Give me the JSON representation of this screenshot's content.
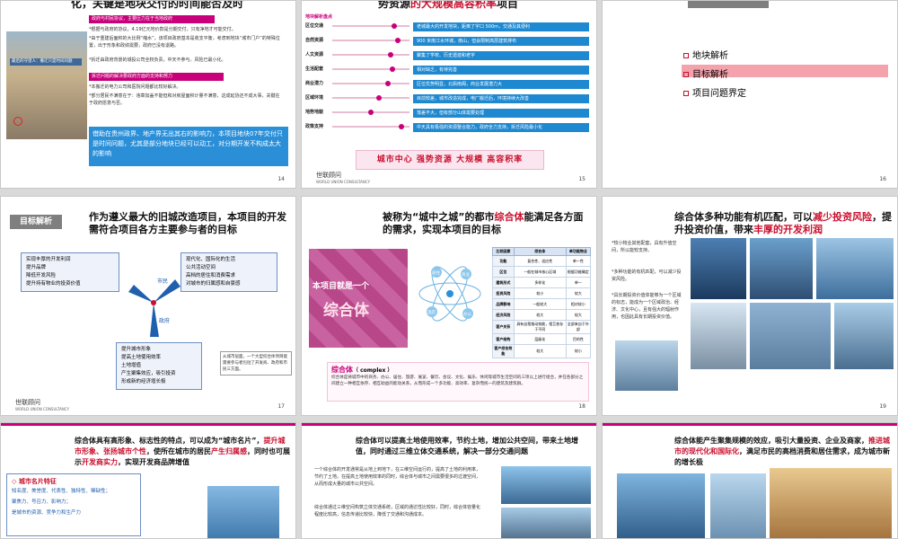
{
  "slides": {
    "s1": {
      "title": "化，关键是地块交付的时间能否及时",
      "banner1": "政府与村民协议，主要压力在于当地政府",
      "p1": "*根据与政府的协议，4.19亿元地价款是分期交付，只有净地才可能交付。",
      "p2": "*由于重建后面积的大比例“缩水”，该项目政府基本是收支平衡，考虑到地块“城市门户”的特殊位置，出于形象和政绩需要，政府已没有退路。",
      "p3": "*拆迁由政府背景的城投公司全权负责，中天不参与。风险已最小化。",
      "banner2": "拆迁问题的解决要政府方面的支持和努力",
      "p4": "*本搬迁的电力公司和医院问题都比较好解决。",
      "p5": "*部分居民不满意在于：违章加盖不能但和对房屋面积计量不满意，这成延协还不成大事，关键在于政府愿意与否。",
      "photo_caption": "最后的守望人：撤迁只是时间问题",
      "blue_text": "借助在贵州政界、地产界无出其右的影响力，本项目地块07年交付只是时间问题，尤其是部分地块已经可以动工，对分期开发不构成太大的影响",
      "page": "14"
    },
    "s2": {
      "title_plain": "势资源",
      "title_red": "的大规模高容积率",
      "title_tail": "项目",
      "section_label": "地块解析盘点",
      "rows": [
        {
          "label": "区位交通",
          "pct": 0.8,
          "text": "老城最大的开发地块，距离了字口 500m，交通及其便利"
        },
        {
          "label": "自然资源",
          "pct": 0.85,
          "text": "900 米南江水环城，南山，但会限制高层建筑排布"
        },
        {
          "label": "人文资源",
          "pct": 0.75,
          "text": "聚集了学校、历史遗迹和老宇"
        },
        {
          "label": "生活配套",
          "pct": 0.78,
          "text": "相对缺乏，有待完善"
        },
        {
          "label": "商业潜力",
          "pct": 0.72,
          "text": "区位优势明显，北衙南阁，商业发展潜力大"
        },
        {
          "label": "区域环境",
          "pct": 0.6,
          "text": "目前较差，城市改造完成，电厂搬迁后，环境持续大改善"
        },
        {
          "label": "地势地貌",
          "pct": 0.5,
          "text": "落差不大，但有部分山体需要处理"
        },
        {
          "label": "政策支持",
          "pct": 0.9,
          "text": "中天具有极强的资源整合能力，政府全力支持，拆迁风险最小化"
        }
      ],
      "slogan": "城市中心  强势资源  大规模  高容积率",
      "logo": "世联顾问",
      "logo_en": "WORLD UNION CONSULTANCY",
      "page": "15"
    },
    "s3": {
      "items": [
        "地块解析",
        "目标解析",
        "项目问题界定"
      ],
      "page": "16"
    },
    "s4": {
      "badge": "目标解析",
      "title": "作为遵义最大的旧城改造项目，本项目的开发需符合项目各方主要参与者的目标",
      "left_box": [
        "实现丰厚的开发利润",
        "提升品牌",
        "降低开发风险",
        "提升持有物业的投资价值"
      ],
      "right_box": [
        "现代化、国际化的生活",
        "公共活动空间",
        "高档的居住和消费需求",
        "对城市的归属感和自豪感"
      ],
      "bottom_box": [
        "提升城市形象",
        "提高土地使用效率",
        "土地增值",
        "产生聚集效应，吸引投资",
        "形成新的经济增长极"
      ],
      "arrow_labels": [
        "市民",
        "开发商",
        "政府"
      ],
      "note": "从城市层面，一个大型综合体项目能需要参与者包括了开发商、政府和市民三方面。",
      "logo": "世联顾问",
      "logo_en": "WORLD UNION CONSULTANCY",
      "page": "17"
    },
    "s5": {
      "title_plain": "被称为“城中之城”的都市",
      "title_red": "综合体",
      "title_tail": "能满足各方面的需求，实现本项目的目标",
      "big_label": "本项目就是一个",
      "big_label2": "综合体",
      "table_headers": [
        "比较因素",
        "综合体",
        "单功能物业"
      ],
      "table_rows": [
        [
          "功能",
          "复合性、适应性",
          "单一性"
        ],
        [
          "区位",
          "一般在城市核心区域",
          "根据功能确定"
        ],
        [
          "建筑形式",
          "多样化",
          "单一"
        ],
        [
          "投资风险",
          "较小",
          "较大"
        ],
        [
          "品牌影响",
          "一般较大",
          "相对较小"
        ],
        [
          "经济风险",
          "较大",
          "较大"
        ],
        [
          "客户关系",
          "具有自我推动效能，相互依存于不同",
          "全部来自于外部"
        ],
        [
          "客户结构",
          "层级化",
          "目的性"
        ],
        [
          "客户综合效能",
          "较大",
          "较小"
        ]
      ],
      "atom_labels": [
        "居住",
        "商业",
        "酒店",
        "办公"
      ],
      "def_title": "综合体",
      "def_en": "（ complex ）",
      "def_text": "综合体是将城市中的商务、办公、居住、旅游、展览、餐饮、会议、文化、娱乐、休闲等城市生活空间的三项以上进行组合，并在各部分之间建立一种相互依存、相互助益的能动关系，从而形成一个多功能、高效率、复杂而统一的建筑及建筑群。",
      "page": "18"
    },
    "s6": {
      "title_plain": "综合体多种功能有机匹配，可以",
      "title_red": "减少投资风险",
      "title_tail": "，提升投资价值，带来",
      "title_red2": "丰厚的开发利润",
      "b1": "*较小物业其他配套，具有升值空间，所以能较支持。",
      "b2": "*多种功能的有机匹配，可以减少投资风险。",
      "b3": "*具长期投资价值体能够为一个区域的标志，能成为一个区域政治、经济、文化中心，且有强大的辐射作用，也因此具有长期投资价值。",
      "page": "19"
    },
    "s7": {
      "title_a": "综合体具有高形象、标志性的特点，可以成为“城市名片”，",
      "title_red": "提升城市形象、张扬城市个性",
      "title_b": "，使所在城市的居民",
      "title_red2": "产生归属感",
      "title_c": "，同时也可展示",
      "title_red3": "开发商实力",
      "title_d": "，实现开发商品牌增值",
      "box_title": "城市名片特征",
      "box_items": [
        "知名度、美誉度、代表性、独特性、稀缺性；",
        "聚焦力、号召力、影响力；",
        "是城市的资源、竞争力和生产力"
      ]
    },
    "s8": {
      "title": "综合体可以提高土地使用效率，节约土地，增加公共空间，带来土地增值，同时通过三维立体交通系统，解决一部分交通问题",
      "b1": "一个综合体的开发通常是从地上到地下，在三维空间运行的，提高了土地的利用率，节约了土地。在提高土地使用效率的同时，综合体与城市之间需要很多的过渡空间，从而形成大量的城市公共空间。",
      "b2": "综合体通过三维空间构筑立体交通系统，区域的通达性比较好，同时，综合体容量化程度比较高，信息传递比较快，降低了交通和沟通成本。"
    },
    "s9": {
      "title_a": "综合体能产生聚集规模的效应，吸引大量投资、企业及商家，",
      "title_red": "推进城市的现代化和国际化",
      "title_b": "，满足市民的高档消费和居住需求，成为城市新的增长极"
    }
  },
  "colors": {
    "accent_red": "#c8102e",
    "accent_magenta": "#c8007a",
    "blue_bar": "#1e88d0",
    "panel_blue": "#2b8fd8"
  }
}
